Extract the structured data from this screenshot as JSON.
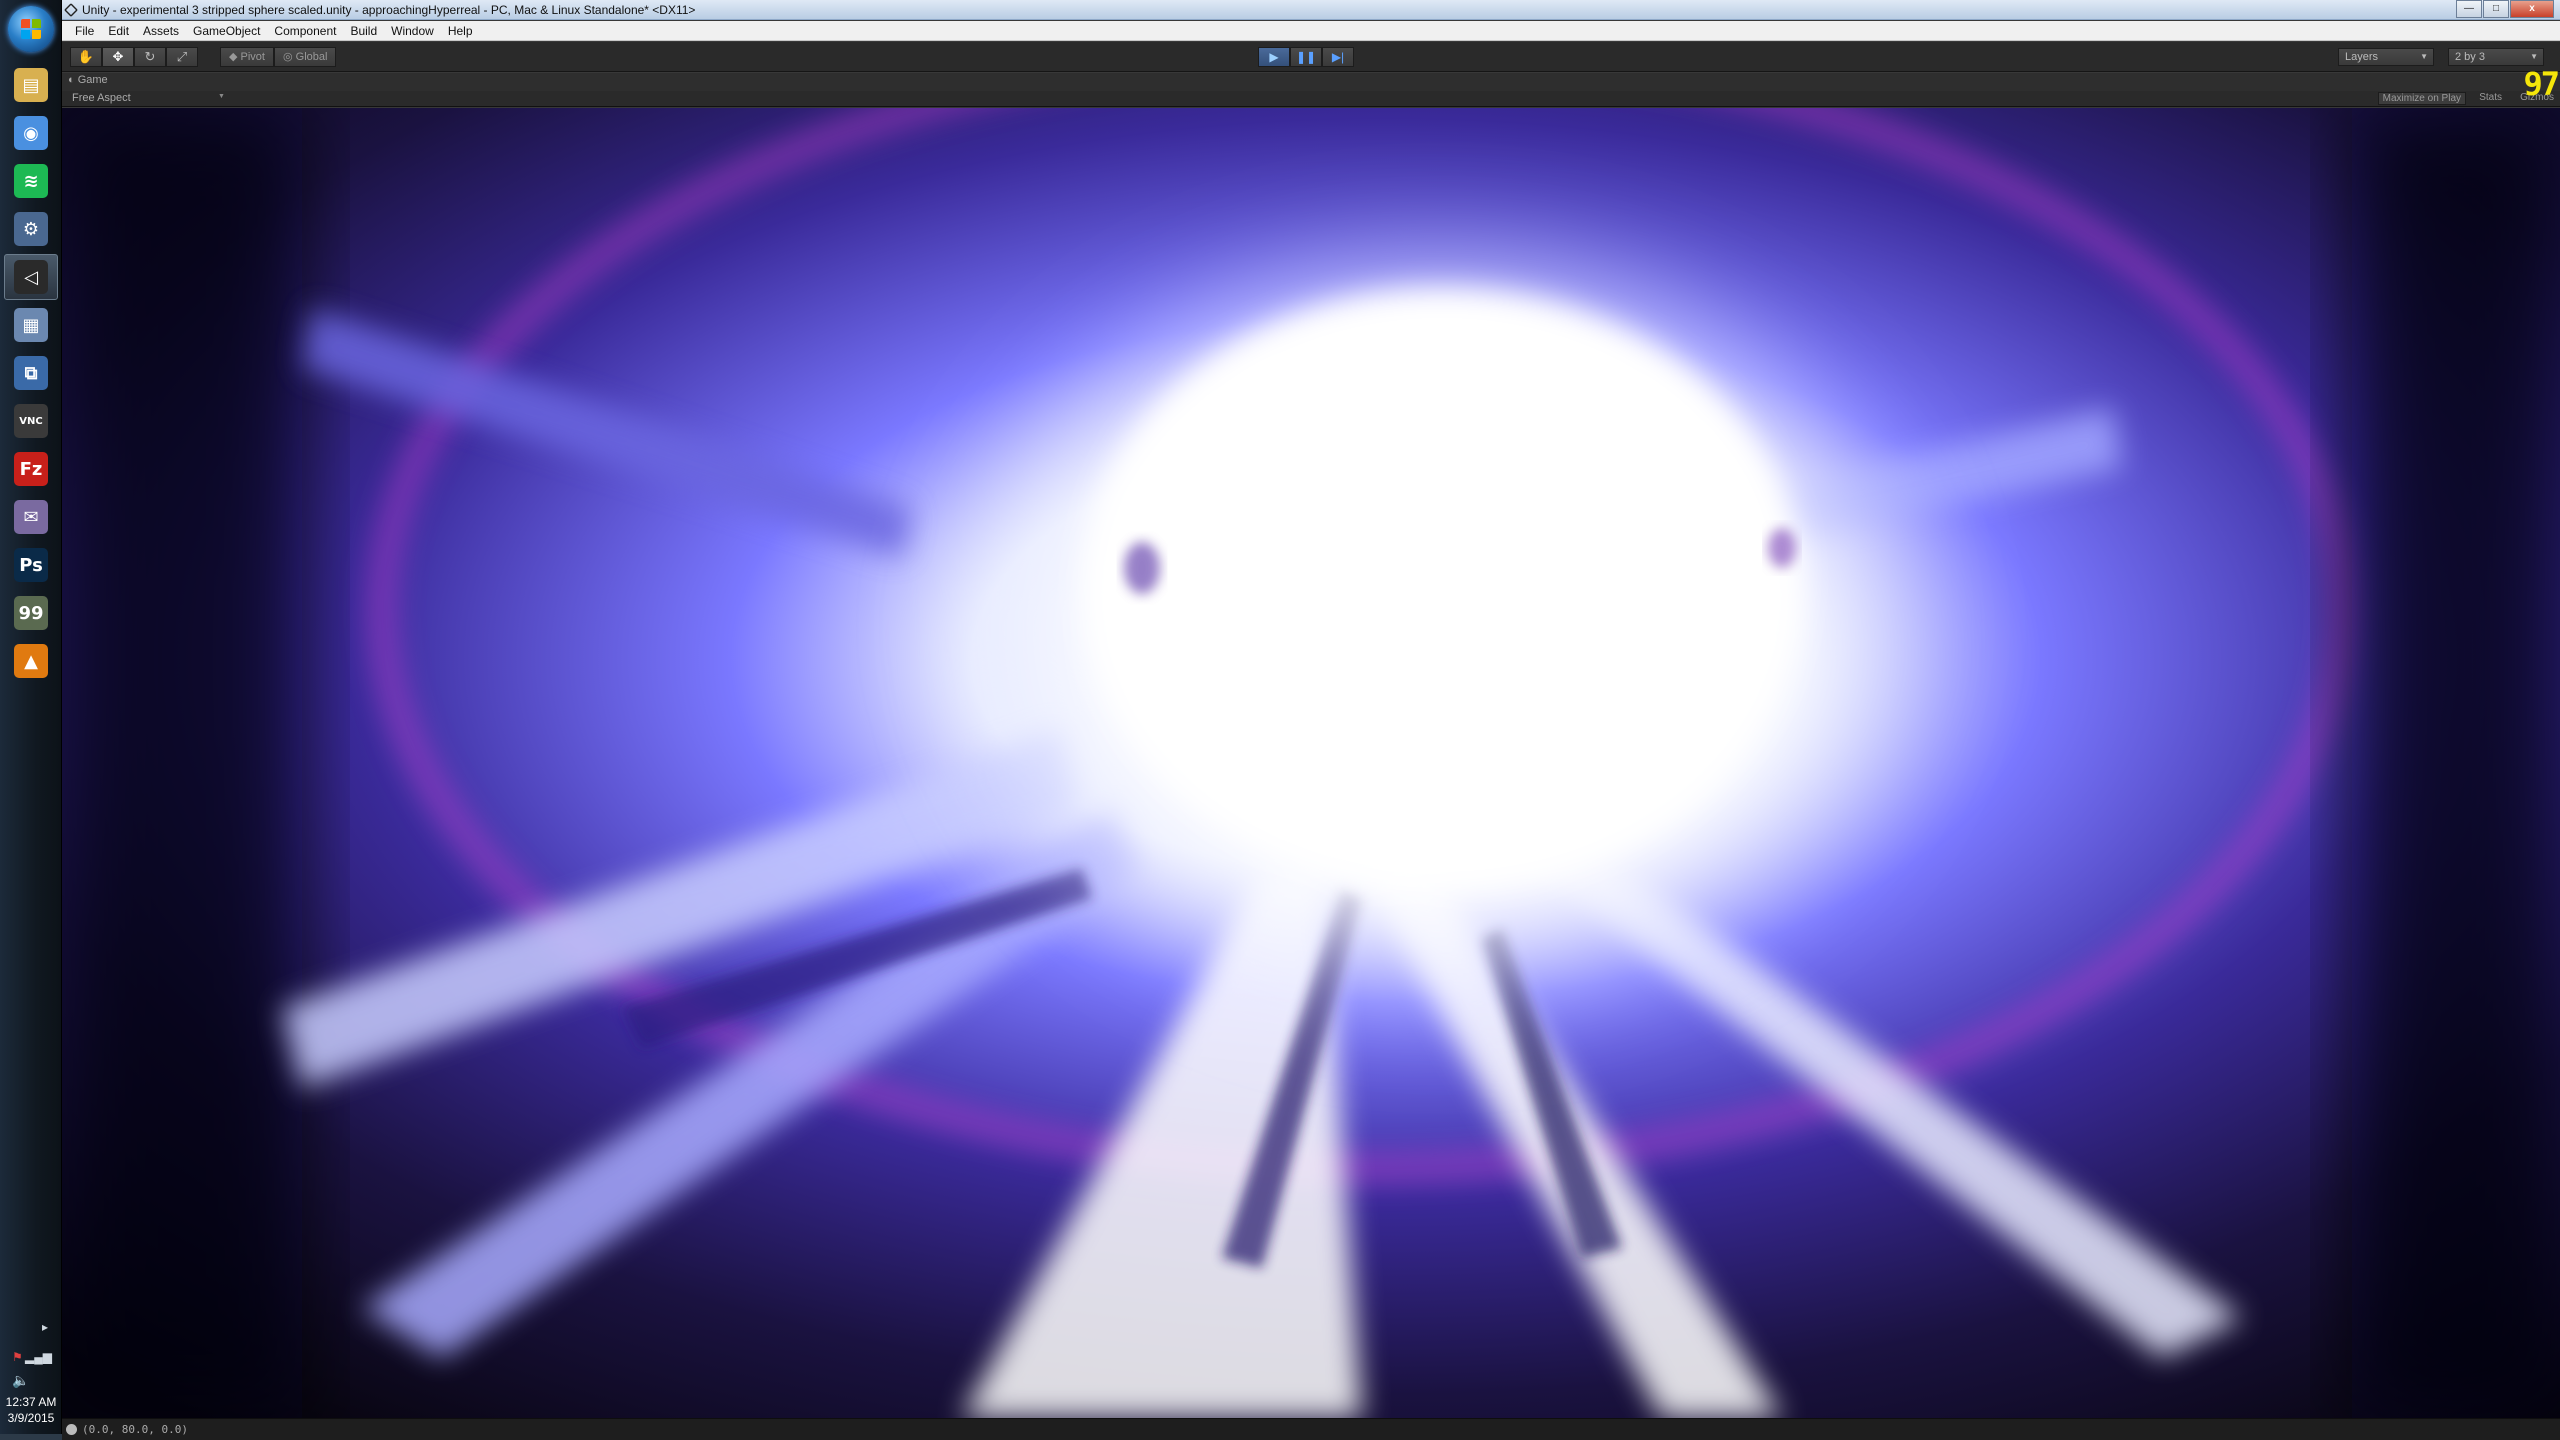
{
  "taskbar": {
    "apps": [
      {
        "name": "file-explorer",
        "glyph": "▤",
        "color": "#d8b050"
      },
      {
        "name": "chrome",
        "glyph": "◉",
        "color": "#4a90e0"
      },
      {
        "name": "spotify",
        "glyph": "≋",
        "color": "#1db954"
      },
      {
        "name": "steam",
        "glyph": "⚙",
        "color": "#4a6890"
      },
      {
        "name": "unity",
        "glyph": "◁",
        "color": "#2a2a2a",
        "active": true
      },
      {
        "name": "calculator",
        "glyph": "▦",
        "color": "#6b88b0"
      },
      {
        "name": "remote-desktop",
        "glyph": "⧉",
        "color": "#3a6aa8"
      },
      {
        "name": "vnc-viewer",
        "glyph": "VNC",
        "color": "#3a3a3a"
      },
      {
        "name": "filezilla",
        "glyph": "Fz",
        "color": "#c8201a"
      },
      {
        "name": "pidgin",
        "glyph": "✉",
        "color": "#7a6aa0"
      },
      {
        "name": "photoshop",
        "glyph": "Ps",
        "color": "#0a2a48"
      },
      {
        "name": "fraps",
        "glyph": "99",
        "color": "#5a6a50"
      },
      {
        "name": "vlc",
        "glyph": "▲",
        "color": "#e07a10"
      }
    ],
    "clock_time": "12:37 AM",
    "clock_date": "3/9/2015"
  },
  "window": {
    "title": "Unity - experimental 3 stripped sphere scaled.unity - approachingHyperreal - PC, Mac & Linux Standalone* <DX11>",
    "controls": {
      "minimize": "—",
      "maximize": "□",
      "close": "x"
    }
  },
  "menu": [
    "File",
    "Edit",
    "Assets",
    "GameObject",
    "Component",
    "Build",
    "Window",
    "Help"
  ],
  "toolbar": {
    "transform_tools": [
      "✋",
      "✥",
      "↻",
      "⤢"
    ],
    "pivot_label": "Pivot",
    "global_label": "Global",
    "play": "▶",
    "pause": "❚❚",
    "step": "▶|",
    "layers_label": "Layers",
    "layout_label": "2 by 3"
  },
  "game_view": {
    "tab_label": "Game",
    "aspect_label": "Free Aspect",
    "maximize_on_play": "Maximize on Play",
    "stats": "Stats",
    "gizmos": "Gizmos",
    "fps": "97"
  },
  "status": {
    "text": "(0.0, 80.0, 0.0)"
  },
  "colors": {
    "fps_yellow": "#f5e60a",
    "glow_core": "#ffffff",
    "glow_blue": "#6a6aff",
    "glow_purple": "#a040d0"
  }
}
